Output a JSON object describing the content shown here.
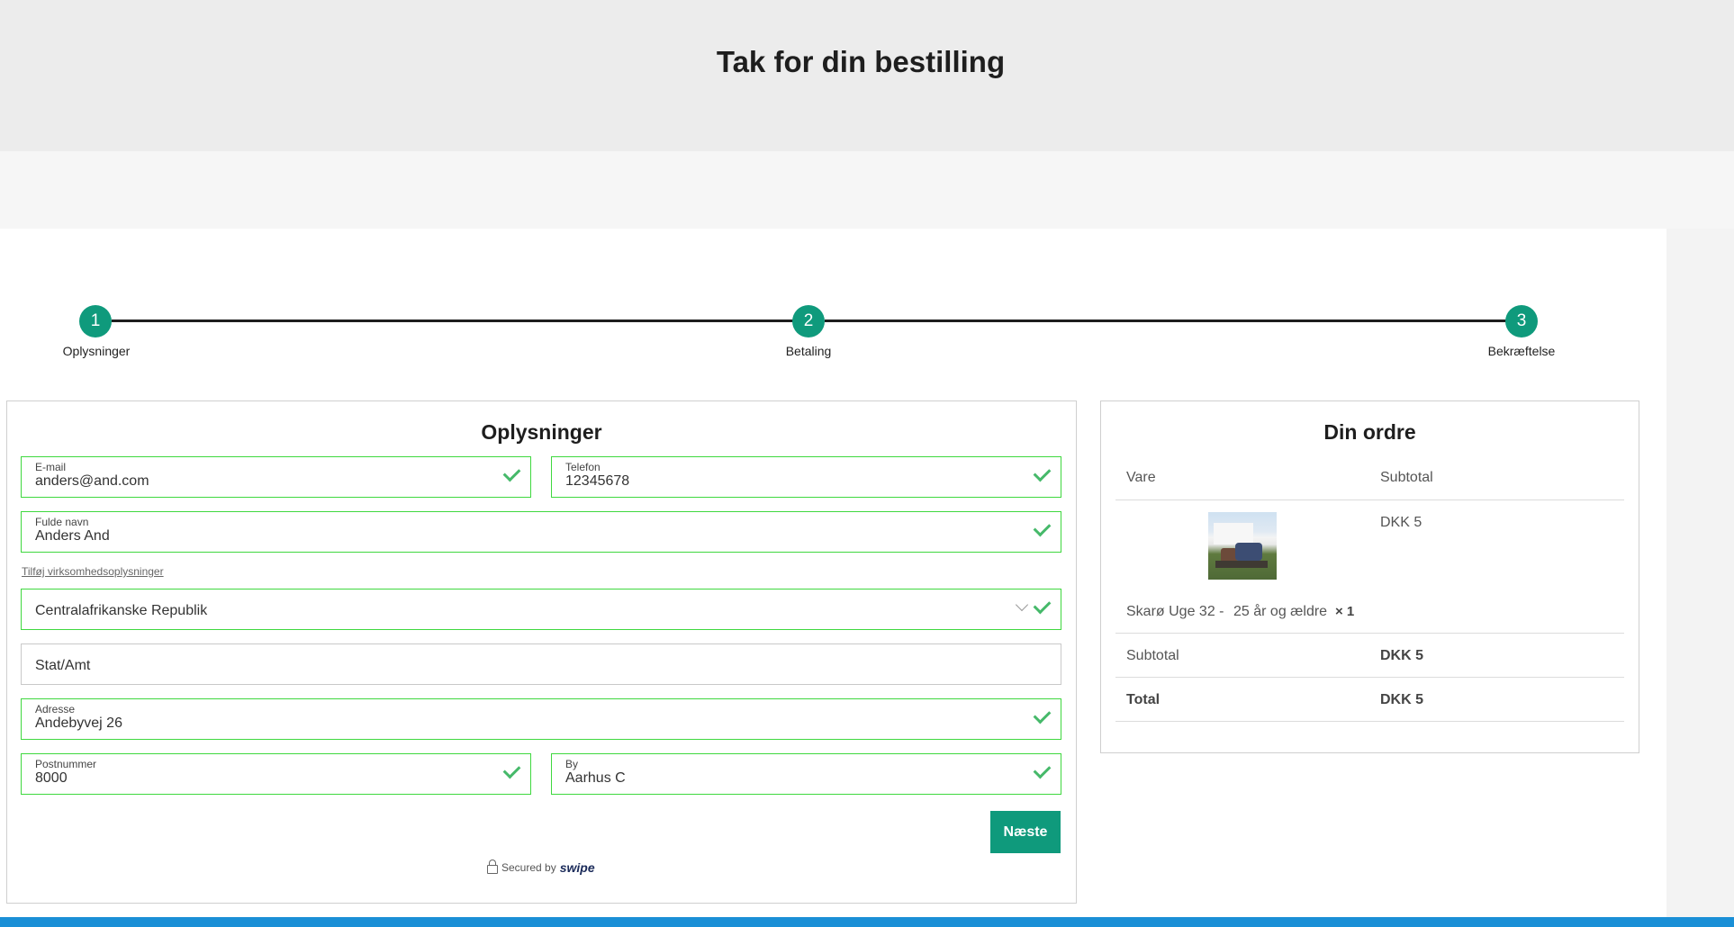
{
  "header": {
    "title": "Tak for din bestilling"
  },
  "stepper": {
    "steps": [
      {
        "number": "1",
        "label": "Oplysninger"
      },
      {
        "number": "2",
        "label": "Betaling"
      },
      {
        "number": "3",
        "label": "Bekræftelse"
      }
    ]
  },
  "form": {
    "title": "Oplysninger",
    "email": {
      "label": "E-mail",
      "value": "anders@and.com"
    },
    "phone": {
      "label": "Telefon",
      "value": "12345678"
    },
    "name": {
      "label": "Fulde navn",
      "value": "Anders And"
    },
    "add_business_link": "Tilføj virksomhedsoplysninger",
    "country": {
      "value": "Centralafrikanske Republik"
    },
    "state": {
      "placeholder": "Stat/Amt"
    },
    "address": {
      "label": "Adresse",
      "value": "Andebyvej 26"
    },
    "postal": {
      "label": "Postnummer",
      "value": "8000"
    },
    "city": {
      "label": "By",
      "value": "Aarhus C"
    },
    "next_button": "Næste",
    "secured_text": "Secured by",
    "secured_brand": "swipe"
  },
  "order": {
    "title": "Din ordre",
    "col_item": "Vare",
    "col_subtotal": "Subtotal",
    "item_price": "DKK 5",
    "item_name": "Skarø Uge 32 -",
    "item_variant": "25 år og ældre",
    "item_qty": "× 1",
    "subtotal_label": "Subtotal",
    "subtotal_value": "DKK 5",
    "total_label": "Total",
    "total_value": "DKK 5"
  },
  "colors": {
    "accent": "#0f9a7c",
    "valid_border": "#3fd83f",
    "check": "#46b96a",
    "bottom_bar": "#1a8fd6"
  }
}
